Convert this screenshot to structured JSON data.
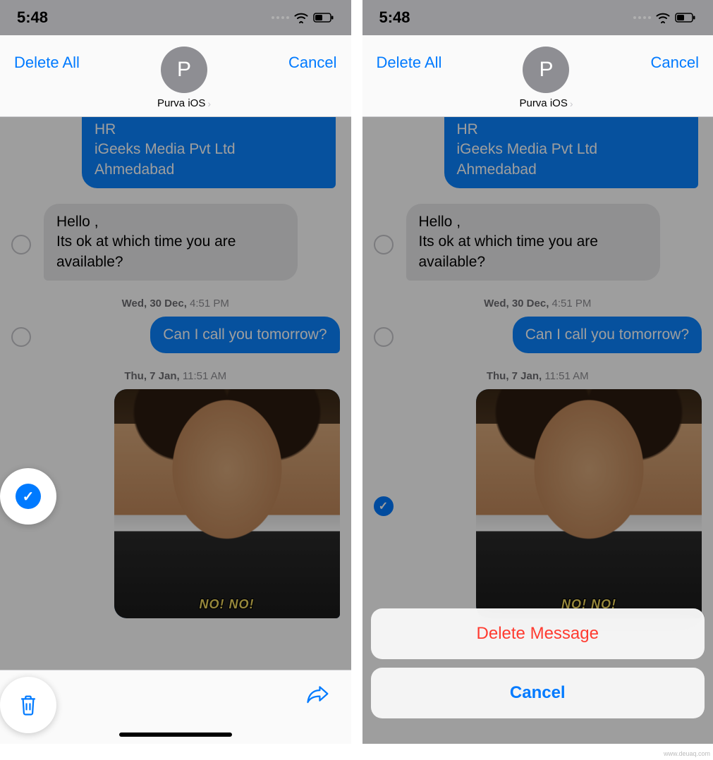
{
  "status": {
    "time": "5:48"
  },
  "topbar": {
    "delete_all": "Delete All",
    "cancel": "Cancel",
    "avatar_initial": "P",
    "contact_name": "Purva iOS"
  },
  "messages": {
    "sent1_line1": "HR",
    "sent1_line2": "iGeeks Media Pvt Ltd",
    "sent1_line3": "Ahmedabad",
    "recv1_line1": "Hello ,",
    "recv1_line2": "Its ok at which time you are available?",
    "ts1_day": "Wed, 30 Dec,",
    "ts1_time": " 4:51 PM",
    "sent2": "Can I call you tomorrow?",
    "ts2_day": "Thu, 7 Jan,",
    "ts2_time": " 11:51 AM",
    "gif_caption": "NO! NO!"
  },
  "action_sheet": {
    "delete_message": "Delete Message",
    "cancel": "Cancel"
  },
  "watermark": "www.deuaq.com"
}
